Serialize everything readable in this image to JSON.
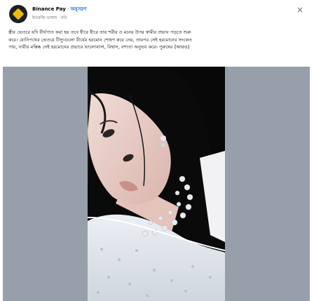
{
  "post": {
    "page_name": "Binance Pay",
    "separator": "·",
    "follow_label": "অনুসরণ",
    "meta": "ইংরেজি ভাষায় · রবি",
    "close_symbol": "×",
    "text_lines": [
      "স্ত্রীর ভেতরে যদি বীর্যপাত করা হয় তবে ধীরে ধীরে তার শরীর ও মনের উপর স্বামীর প্রভাব পড়তে শুরু",
      "করে। যোনিপথের ভেতরে টিস্যুগুলো বীর্যের হরমোন শোষণ করে নেয়, তারপর সেই হরমোনের সংকেত",
      "পায়, নারীর মস্তিষ্ক সেই হরমোনের প্রভাবে ভালোবাসা, বিশ্বাস, বশ্যতা অনুভব করে। পুরুষের"
    ],
    "see_more_label": "(আরও)"
  },
  "colors": {
    "link_blue": "#1b74e4",
    "meta_gray": "#65676b",
    "text_dark": "#050505",
    "media_bg": "#97a0aa",
    "brand_gold": "#f0b90b"
  },
  "icons": {
    "avatar": "binance-logo",
    "close": "close-icon"
  }
}
